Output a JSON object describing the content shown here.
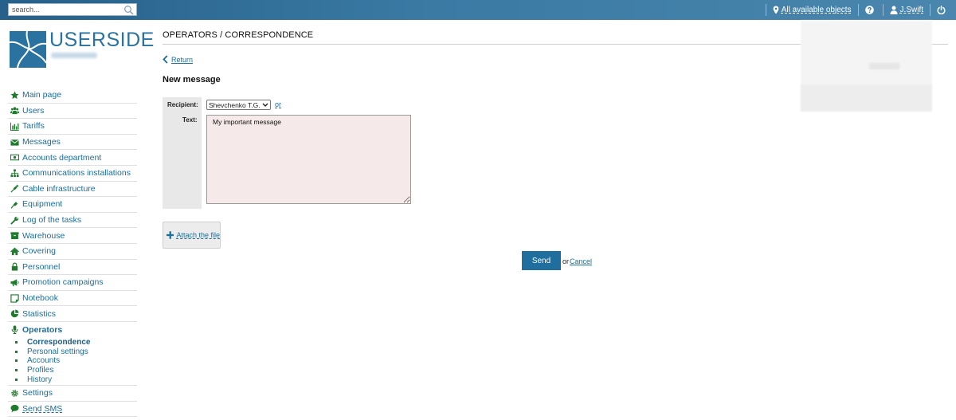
{
  "topbar": {
    "search_placeholder": "search...",
    "objects_label": "All available objects",
    "user_label": "J.Swift"
  },
  "logo": {
    "text": "USERSIDE"
  },
  "sidebar": {
    "items": [
      {
        "label": "Main page",
        "icon": "star-icon"
      },
      {
        "label": "Users",
        "icon": "users-icon"
      },
      {
        "label": "Tariffs",
        "icon": "bar-chart-icon"
      },
      {
        "label": "Messages",
        "icon": "envelope-icon"
      },
      {
        "label": "Accounts department",
        "icon": "money-icon"
      },
      {
        "label": "Communications installations",
        "icon": "sitemap-icon"
      },
      {
        "label": "Cable infrastructure",
        "icon": "plug-icon"
      },
      {
        "label": "Equipment",
        "icon": "plug-wire-icon"
      },
      {
        "label": "Log of the tasks",
        "icon": "wrench-icon"
      },
      {
        "label": "Warehouse",
        "icon": "box-icon"
      },
      {
        "label": "Covering",
        "icon": "home-icon"
      },
      {
        "label": "Personnel",
        "icon": "lock-icon"
      },
      {
        "label": "Promotion campaigns",
        "icon": "megaphone-icon"
      },
      {
        "label": "Notebook",
        "icon": "note-icon"
      },
      {
        "label": "Statistics",
        "icon": "pie-chart-icon"
      },
      {
        "label": "Operators",
        "icon": "microphone-icon"
      }
    ],
    "operators_sub": [
      {
        "label": "Correspondence"
      },
      {
        "label": "Personal settings"
      },
      {
        "label": "Accounts"
      },
      {
        "label": "Profiles"
      },
      {
        "label": "History"
      }
    ],
    "settings_label": "Settings",
    "send_sms_label": "Send SMS"
  },
  "main": {
    "breadcrumb": "OPERATORS / CORRESPONDENCE",
    "return_label": "Return",
    "heading": "New message",
    "recipient_label": "Recipient:",
    "recipient_value": "Shevchenko T.G.",
    "or_label": "or",
    "text_label": "Text:",
    "text_value": "My important message",
    "attach_label": "Attach the file",
    "send_label": "Send",
    "or_text": "or",
    "cancel_label": "Cancel"
  },
  "colors": {
    "brand": "#2a72a0",
    "link": "#1a6e9c",
    "icon_green": "#1e7a2c",
    "send_button": "#1f6e9e",
    "textarea_bg": "#f5e9e9"
  }
}
